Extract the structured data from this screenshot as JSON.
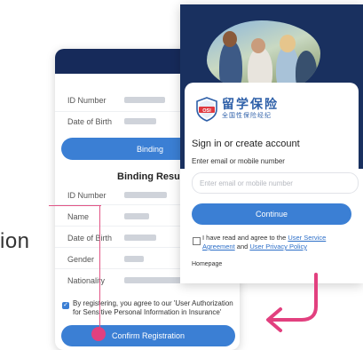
{
  "annotation": {
    "partial_word": "ion"
  },
  "left_screen": {
    "fields_top": [
      {
        "label": "ID Number"
      },
      {
        "label": "Date of Birth"
      }
    ],
    "binding_button": "Binding",
    "result_title": "Binding Result",
    "fields_result": [
      {
        "label": "ID Number"
      },
      {
        "label": "Name"
      },
      {
        "label": "Date of Birth"
      },
      {
        "label": "Gender"
      },
      {
        "label": "Nationality"
      }
    ],
    "consent_text": "By registering, you agree to our 'User Authorization for Sensitive Personal Information in Insurance'",
    "confirm_button": "Confirm Registration"
  },
  "right_screen": {
    "brand": {
      "name_cn": "留学保险",
      "sub_cn": "全国性保险经纪",
      "logo_text": "OSI"
    },
    "signin_title": "Sign in or create account",
    "email_label": "Enter email or mobile number",
    "email_placeholder": "Enter email or mobile number",
    "continue_button": "Continue",
    "agree_prefix": "I have read and agree to the",
    "agree_link1": "User Service Agreement",
    "agree_mid": "and",
    "agree_link2": "User Privacy Policy",
    "homepage": "Homepage"
  },
  "colors": {
    "accent": "#3b7fd4",
    "dark_header": "#19305f",
    "annotation_pink": "#e25586"
  }
}
